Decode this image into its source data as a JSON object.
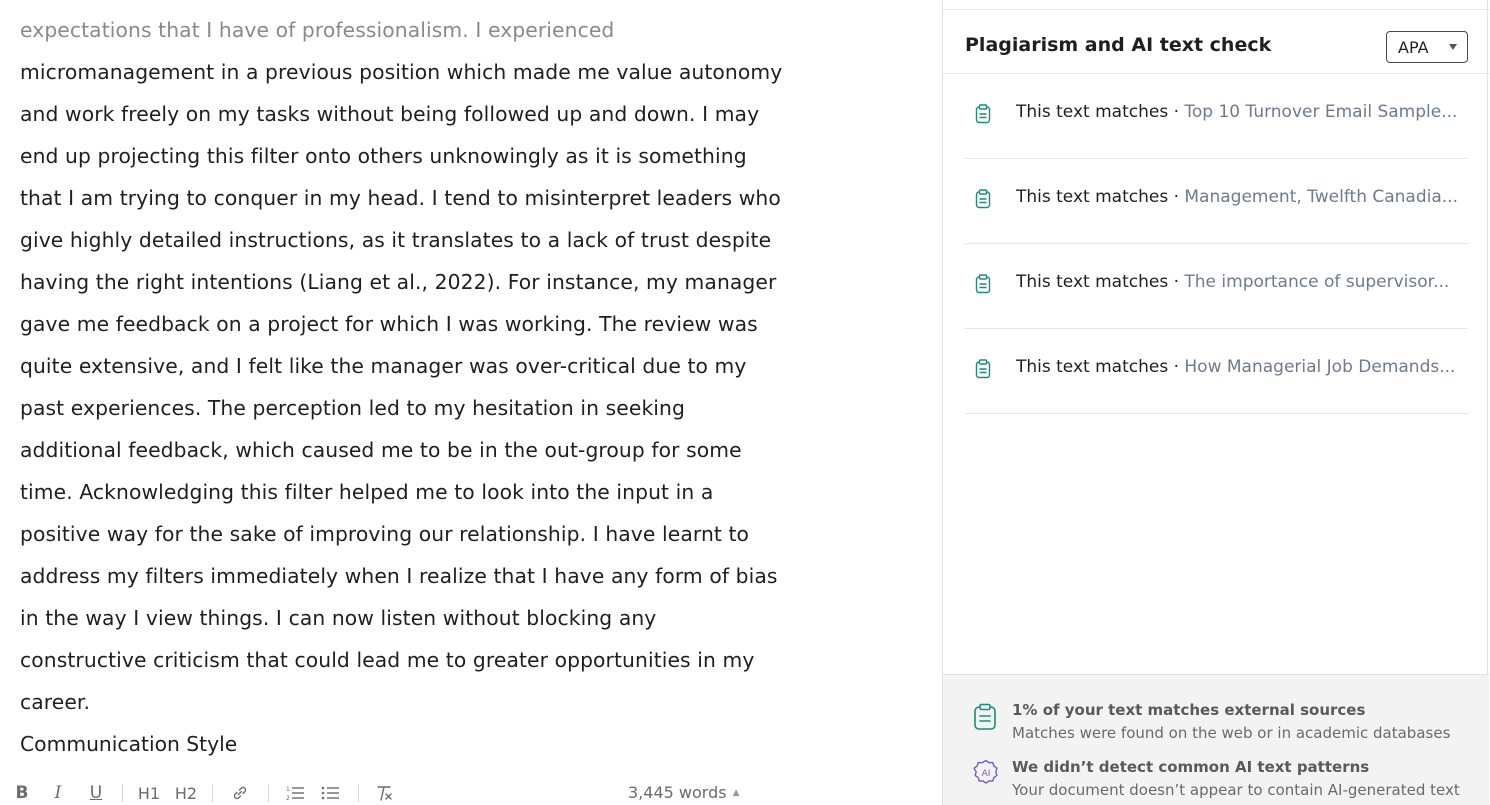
{
  "document": {
    "lines": [
      "expectations that I have of professionalism. I experienced",
      "micromanagement in a previous position which made me value autonomy",
      "and work freely on my tasks without being followed up and down. I may",
      "end up projecting this filter onto others unknowingly as it is something",
      "that I am trying to conquer in my head. I tend to misinterpret leaders who",
      "give highly detailed instructions, as it translates to a lack of trust despite",
      "having the right intentions (Liang et al., 2022). For instance, my manager",
      "gave me feedback on a project for which I was working. The review was",
      "quite extensive, and I felt like the manager was over-critical due to my",
      "past experiences. The perception led to my hesitation in seeking",
      "additional feedback, which caused me to be in the out-group for some",
      "time. Acknowledging this filter helped me to look into the input in a",
      "positive way for the sake of improving our relationship. I have learnt to",
      "address my filters immediately when I realize that I have any form of bias",
      "in the way I view things. I can now listen without blocking any",
      "constructive criticism that could lead me to greater opportunities in my",
      "career."
    ],
    "heading": "Communication Style"
  },
  "toolbar": {
    "bold": "B",
    "italic": "I",
    "underline": "U",
    "h1": "H1",
    "h2": "H2",
    "word_count": "3,445 words"
  },
  "panel": {
    "title": "Plagiarism and AI text check",
    "citation_style": "APA",
    "matches": [
      {
        "label": "This text matches · ",
        "source": "Top 10 Turnover Email Sample..."
      },
      {
        "label": "This text matches · ",
        "source": "Management, Twelfth Canadia..."
      },
      {
        "label": "This text matches · ",
        "source": "The importance of supervisor..."
      },
      {
        "label": "This text matches · ",
        "source": "How Managerial Job Demands..."
      }
    ],
    "summary": {
      "plagiarism_title": "1% of your text matches external sources",
      "plagiarism_sub": "Matches were found on the web or in academic databases",
      "ai_title": "We didn’t detect common AI text patterns",
      "ai_sub": "Your document doesn’t appear to contain AI-generated text",
      "ai_icon_text": "AI"
    }
  },
  "colors": {
    "accent_teal": "#1a8c7e",
    "ai_purple": "#7a5cc2",
    "source_gray": "#6e7b8c"
  }
}
